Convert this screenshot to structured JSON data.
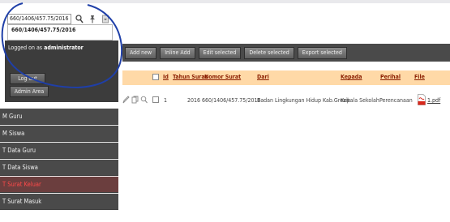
{
  "search": {
    "value": "660/1406/457.75/2016",
    "suggestion": "660/1406/457.75/2016"
  },
  "session": {
    "logged_prefix": "Logged on as",
    "user": "administrator",
    "logout_label": "Log out",
    "admin_label": "Admin Area"
  },
  "menu": {
    "items": [
      {
        "label": "M Guru"
      },
      {
        "label": "M Siswa"
      },
      {
        "label": "T Data Guru"
      },
      {
        "label": "T Data Siswa"
      },
      {
        "label": "T Surat Keluar"
      },
      {
        "label": "T Surat Masuk"
      }
    ],
    "active_index": 4
  },
  "toolbar": {
    "add_new": "Add new",
    "inline_add": "Inline Add",
    "edit_selected": "Edit selected",
    "delete_selected": "Delete selected",
    "export_selected": "Export selected"
  },
  "table": {
    "headers": {
      "id": "Id",
      "tahun": "Tahun Surat",
      "nomor": "Nomor Surat",
      "dari": "Dari",
      "kepada": "Kepada",
      "perihal": "Perihal",
      "file": "File"
    },
    "rows": [
      {
        "id": "1",
        "tahun": "2016",
        "nomor": "660/1406/457.75/2016",
        "dari": "Badan Lingkungan Hidup Kab.Gresik",
        "kepada": "Kepala Sekolah",
        "perihal": "Perencanaan",
        "file": "1.pdf"
      }
    ]
  },
  "colors": {
    "header_bg": "#ffd9a7",
    "header_text": "#8a1e00",
    "panel_bg": "#3c3c3c",
    "menu_bg": "#4a4a4a",
    "menu_active_text": "#ff4a4a",
    "callout": "#1f3fa8"
  }
}
